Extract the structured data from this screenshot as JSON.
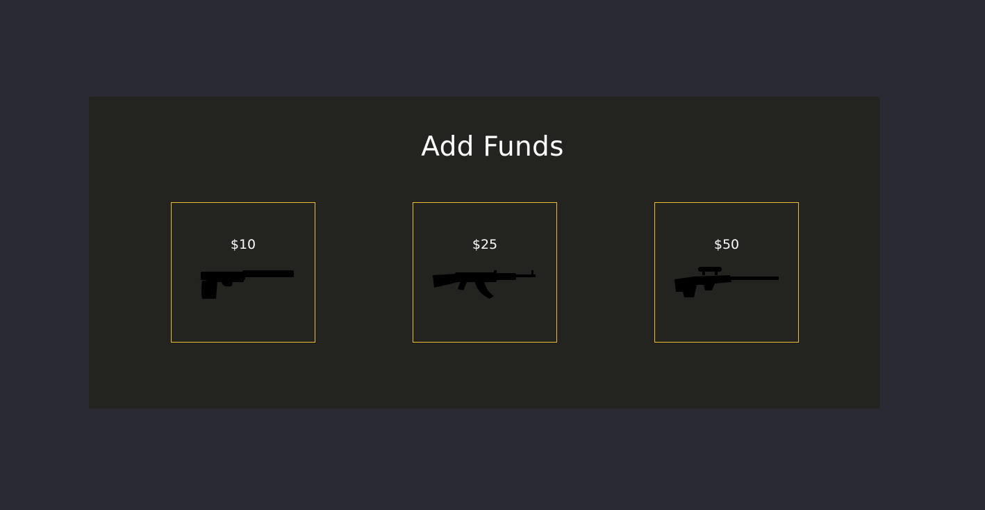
{
  "page": {
    "title": "Add Funds"
  },
  "options": [
    {
      "price": "$10",
      "icon": "pistol-icon"
    },
    {
      "price": "$25",
      "icon": "assault-rifle-icon"
    },
    {
      "price": "$50",
      "icon": "sniper-rifle-icon"
    }
  ],
  "colors": {
    "background": "#292a33",
    "panel": "#23241f",
    "accent_border": "#f0be2e",
    "text": "#ffffff",
    "icon": "#000000"
  }
}
